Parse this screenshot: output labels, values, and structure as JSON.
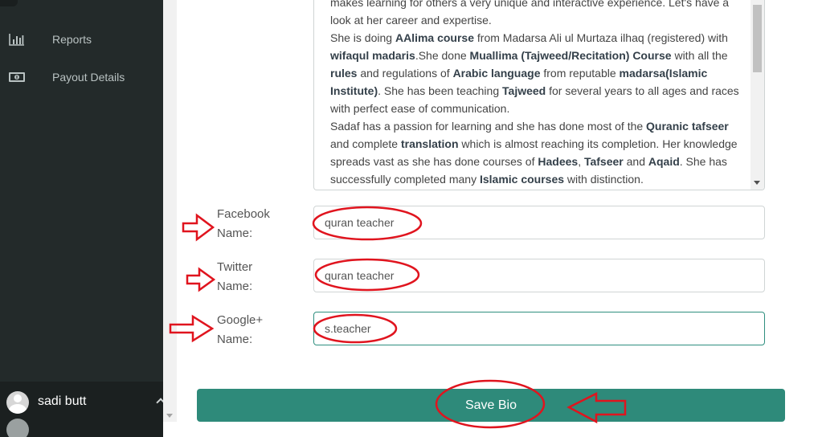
{
  "sidebar": {
    "items": [
      {
        "label": "Reports",
        "icon": "bar-chart-icon"
      },
      {
        "label": "Payout Details",
        "icon": "money-icon"
      }
    ],
    "user": {
      "name": "sadi butt"
    }
  },
  "bio": {
    "paragraphs": [
      [
        {
          "t": "makes learning for others a very unique and interactive experience. Let's have a look at her career and expertise."
        }
      ],
      [
        {
          "t": "She is doing "
        },
        {
          "b": "AAlima course"
        },
        {
          "t": " from Madarsa Ali ul Murtaza ilhaq (registered) with "
        },
        {
          "b": "wifaqul madaris"
        },
        {
          "t": ".She done "
        },
        {
          "b": "Muallima (Tajweed/Recitation) Course"
        },
        {
          "t": " with all the "
        },
        {
          "b": "rules"
        },
        {
          "t": " and regulations of "
        },
        {
          "b": "Arabic language"
        },
        {
          "t": " from reputable "
        },
        {
          "b": "madarsa(Islamic Institute)"
        },
        {
          "t": ". She has been teaching "
        },
        {
          "b": "Tajweed"
        },
        {
          "t": " for several years to all ages and races with perfect ease of communication."
        }
      ],
      [
        {
          "t": "Sadaf has a passion for learning and she has done most of the "
        },
        {
          "b": "Quranic tafseer"
        },
        {
          "t": " and complete "
        },
        {
          "b": "translation"
        },
        {
          "t": " which is almost reaching its completion. Her knowledge spreads vast as she has done courses of "
        },
        {
          "b": "Hadees"
        },
        {
          "t": ", "
        },
        {
          "b": "Tafseer"
        },
        {
          "t": " and "
        },
        {
          "b": "Aqaid"
        },
        {
          "t": ". She has successfully completed many "
        },
        {
          "b": "Islamic courses"
        },
        {
          "t": " with distinction."
        }
      ]
    ]
  },
  "form": {
    "facebook": {
      "label_line1": "Facebook",
      "label_line2": "Name:",
      "value": "quran teacher"
    },
    "twitter": {
      "label_line1": "Twitter",
      "label_line2": "Name:",
      "value": "quran teacher"
    },
    "google": {
      "label_line1": "Google+",
      "label_line2": "Name:",
      "value": "s.teacher"
    },
    "save_label": "Save Bio"
  },
  "colors": {
    "sidebar_bg": "#232a2a",
    "button_bg": "#2e8a7a",
    "annotation_red": "#e0141e"
  }
}
